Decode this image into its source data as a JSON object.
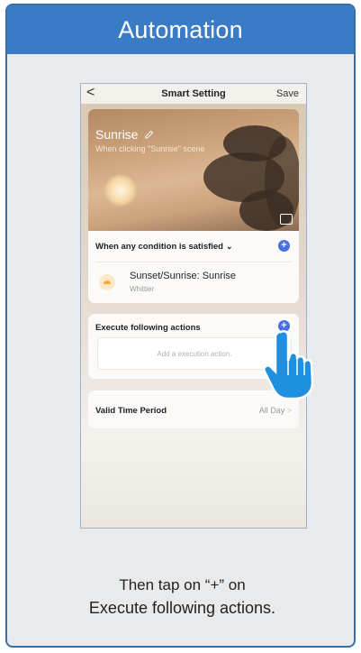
{
  "header": {
    "title": "Automation"
  },
  "phone": {
    "topbar": {
      "back_glyph": "<",
      "title": "Smart Setting",
      "save_label": "Save"
    },
    "hero": {
      "title": "Sunrise",
      "subtitle": "When clicking \"Sunrise\" scene",
      "edit_icon": "pencil-icon",
      "image_icon": "image-icon"
    },
    "condition": {
      "label": "When any condition is satisfied",
      "chevron": "⌄",
      "item_title": "Sunset/Sunrise: Sunrise",
      "item_sub": "Whittier"
    },
    "execute": {
      "label": "Execute following actions",
      "placeholder": "Add a execution action."
    },
    "valid": {
      "label": "Valid Time Period",
      "value": "All Day",
      "chevron": ">"
    }
  },
  "caption": {
    "line1": "Then tap on “+” on",
    "line2_bold": "Execute following actions",
    "line2_end": "."
  },
  "colors": {
    "header_bg": "#3a7bc5",
    "accent_plus": "#4a6fe0",
    "hand": "#1f8fe0"
  }
}
